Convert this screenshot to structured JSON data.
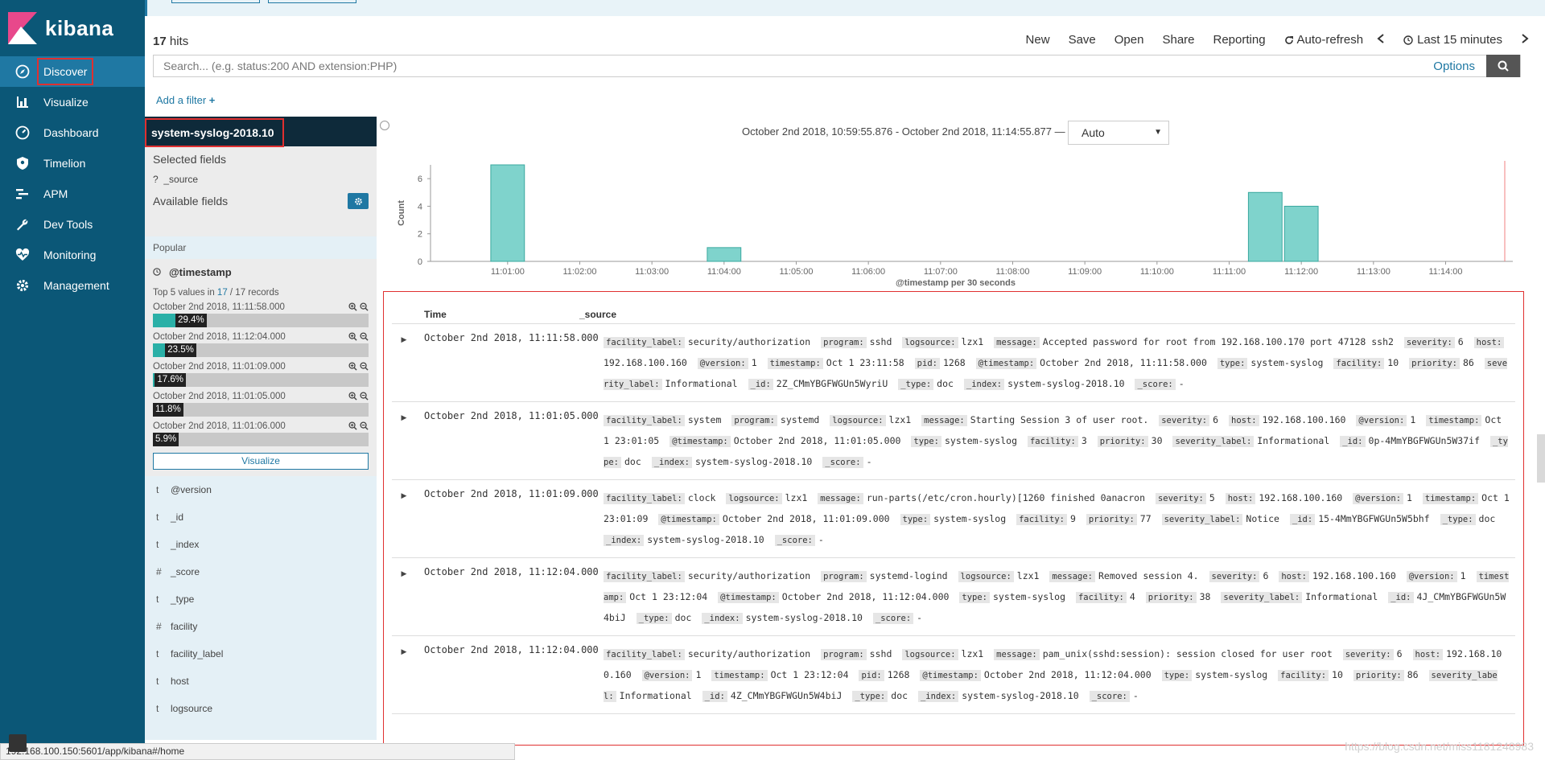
{
  "app": {
    "name": "kibana"
  },
  "nav": [
    {
      "label": "Discover",
      "icon": "compass-icon",
      "active": true
    },
    {
      "label": "Visualize",
      "icon": "bar-chart-icon"
    },
    {
      "label": "Dashboard",
      "icon": "dashboard-icon"
    },
    {
      "label": "Timelion",
      "icon": "shield-icon"
    },
    {
      "label": "APM",
      "icon": "apm-icon"
    },
    {
      "label": "Dev Tools",
      "icon": "wrench-icon"
    },
    {
      "label": "Monitoring",
      "icon": "heartbeat-icon"
    },
    {
      "label": "Management",
      "icon": "gear-icon"
    }
  ],
  "header": {
    "hits_count": "17",
    "hits_label": "hits",
    "menu": [
      "New",
      "Save",
      "Open",
      "Share",
      "Reporting"
    ],
    "auto_refresh": "Auto-refresh",
    "time_range": "Last 15 minutes"
  },
  "search": {
    "placeholder": "Search... (e.g. status:200 AND extension:PHP)",
    "options": "Options"
  },
  "filter": {
    "add": "Add a filter"
  },
  "sidebar": {
    "index": "system-syslog-2018.10",
    "selected_fields": "Selected fields",
    "source_field": "_source",
    "available_fields": "Available fields",
    "popular": "Popular",
    "timestamp_field": "@timestamp",
    "top5_prefix": "Top 5 values in",
    "top5_count": "17",
    "top5_suffix": "/ 17 records",
    "values": [
      {
        "label": "October 2nd 2018, 11:11:58.000",
        "pct": 29.4
      },
      {
        "label": "October 2nd 2018, 11:12:04.000",
        "pct": 23.5
      },
      {
        "label": "October 2nd 2018, 11:01:09.000",
        "pct": 17.6
      },
      {
        "label": "October 2nd 2018, 11:01:05.000",
        "pct": 11.8
      },
      {
        "label": "October 2nd 2018, 11:01:06.000",
        "pct": 5.9
      }
    ],
    "visualize_button": "Visualize",
    "fields": [
      {
        "type": "t",
        "name": "@version"
      },
      {
        "type": "t",
        "name": "_id"
      },
      {
        "type": "t",
        "name": "_index"
      },
      {
        "type": "#",
        "name": "_score"
      },
      {
        "type": "t",
        "name": "_type"
      },
      {
        "type": "#",
        "name": "facility"
      },
      {
        "type": "t",
        "name": "facility_label"
      },
      {
        "type": "t",
        "name": "host"
      },
      {
        "type": "t",
        "name": "logsource"
      }
    ]
  },
  "chart_header": {
    "range": "October 2nd 2018, 10:59:55.876 - October 2nd 2018, 11:14:55.877 —",
    "interval": "Auto"
  },
  "chart_data": {
    "type": "bar",
    "xlabel": "@timestamp per 30 seconds",
    "ylabel": "Count",
    "ylim": [
      0,
      7
    ],
    "yticks": [
      0,
      2,
      4,
      6
    ],
    "xticks": [
      "11:01:00",
      "11:02:00",
      "11:03:00",
      "11:04:00",
      "11:05:00",
      "11:06:00",
      "11:07:00",
      "11:08:00",
      "11:09:00",
      "11:10:00",
      "11:11:00",
      "11:12:00",
      "11:13:00",
      "11:14:00"
    ],
    "x_start": "10:59:55.876",
    "x_end": "11:14:55.877",
    "bucket_seconds": 30,
    "bars": [
      {
        "x": "11:01:00",
        "value": 7
      },
      {
        "x": "11:04:00",
        "value": 1
      },
      {
        "x": "11:11:30",
        "value": 5
      },
      {
        "x": "11:12:00",
        "value": 4
      }
    ],
    "grid": false,
    "bar_color": "#7fd3cc"
  },
  "table": {
    "col_time": "Time",
    "col_source": "_source",
    "rows": [
      {
        "time": "October 2nd 2018, 11:11:58.000",
        "fields": [
          [
            "facility_label:",
            "security/authorization"
          ],
          [
            "program:",
            "sshd"
          ],
          [
            "logsource:",
            "lzx1"
          ],
          [
            "message:",
            "Accepted password for root from 192.168.100.170 port 47128 ssh2"
          ],
          [
            "severity:",
            "6"
          ],
          [
            "host:",
            "192.168.100.160"
          ],
          [
            "@version:",
            "1"
          ],
          [
            "timestamp:",
            "Oct 1 23:11:58"
          ],
          [
            "pid:",
            "1268"
          ],
          [
            "@timestamp:",
            "October 2nd 2018, 11:11:58.000"
          ],
          [
            "type:",
            "system-syslog"
          ],
          [
            "facility:",
            "10"
          ],
          [
            "priority:",
            "86"
          ],
          [
            "severity_label:",
            "Informational"
          ],
          [
            "_id:",
            "2Z_CMmYBGFWGUn5WyriU"
          ],
          [
            "_type:",
            "doc"
          ],
          [
            "_index:",
            "system-syslog-2018.10"
          ],
          [
            "_score:",
            "-"
          ]
        ]
      },
      {
        "time": "October 2nd 2018, 11:01:05.000",
        "fields": [
          [
            "facility_label:",
            "system"
          ],
          [
            "program:",
            "systemd"
          ],
          [
            "logsource:",
            "lzx1"
          ],
          [
            "message:",
            "Starting Session 3 of user root."
          ],
          [
            "severity:",
            "6"
          ],
          [
            "host:",
            "192.168.100.160"
          ],
          [
            "@version:",
            "1"
          ],
          [
            "timestamp:",
            "Oct 1 23:01:05"
          ],
          [
            "@timestamp:",
            "October 2nd 2018, 11:01:05.000"
          ],
          [
            "type:",
            "system-syslog"
          ],
          [
            "facility:",
            "3"
          ],
          [
            "priority:",
            "30"
          ],
          [
            "severity_label:",
            "Informational"
          ],
          [
            "_id:",
            "0p-4MmYBGFWGUn5W37if"
          ],
          [
            "_type:",
            "doc"
          ],
          [
            "_index:",
            "system-syslog-2018.10"
          ],
          [
            "_score:",
            "-"
          ]
        ]
      },
      {
        "time": "October 2nd 2018, 11:01:09.000",
        "fields": [
          [
            "facility_label:",
            "clock"
          ],
          [
            "logsource:",
            "lzx1"
          ],
          [
            "message:",
            "run-parts(/etc/cron.hourly)[1260 finished 0anacron"
          ],
          [
            "severity:",
            "5"
          ],
          [
            "host:",
            "192.168.100.160"
          ],
          [
            "@version:",
            "1"
          ],
          [
            "timestamp:",
            "Oct 1 23:01:09"
          ],
          [
            "@timestamp:",
            "October 2nd 2018, 11:01:09.000"
          ],
          [
            "type:",
            "system-syslog"
          ],
          [
            "facility:",
            "9"
          ],
          [
            "priority:",
            "77"
          ],
          [
            "severity_label:",
            "Notice"
          ],
          [
            "_id:",
            "15-4MmYBGFWGUn5W5bhf"
          ],
          [
            "_type:",
            "doc"
          ],
          [
            "_index:",
            "system-syslog-2018.10"
          ],
          [
            "_score:",
            "-"
          ]
        ]
      },
      {
        "time": "October 2nd 2018, 11:12:04.000",
        "fields": [
          [
            "facility_label:",
            "security/authorization"
          ],
          [
            "program:",
            "systemd-logind"
          ],
          [
            "logsource:",
            "lzx1"
          ],
          [
            "message:",
            "Removed session 4."
          ],
          [
            "severity:",
            "6"
          ],
          [
            "host:",
            "192.168.100.160"
          ],
          [
            "@version:",
            "1"
          ],
          [
            "timestamp:",
            "Oct 1 23:12:04"
          ],
          [
            "@timestamp:",
            "October 2nd 2018, 11:12:04.000"
          ],
          [
            "type:",
            "system-syslog"
          ],
          [
            "facility:",
            "4"
          ],
          [
            "priority:",
            "38"
          ],
          [
            "severity_label:",
            "Informational"
          ],
          [
            "_id:",
            "4J_CMmYBGFWGUn5W4biJ"
          ],
          [
            "_type:",
            "doc"
          ],
          [
            "_index:",
            "system-syslog-2018.10"
          ],
          [
            "_score:",
            "-"
          ]
        ]
      },
      {
        "time": "October 2nd 2018, 11:12:04.000",
        "fields": [
          [
            "facility_label:",
            "security/authorization"
          ],
          [
            "program:",
            "sshd"
          ],
          [
            "logsource:",
            "lzx1"
          ],
          [
            "message:",
            "pam_unix(sshd:session): session closed for user root"
          ],
          [
            "severity:",
            "6"
          ],
          [
            "host:",
            "192.168.100.160"
          ],
          [
            "@version:",
            "1"
          ],
          [
            "timestamp:",
            "Oct 1 23:12:04"
          ],
          [
            "pid:",
            "1268"
          ],
          [
            "@timestamp:",
            "October 2nd 2018, 11:12:04.000"
          ],
          [
            "type:",
            "system-syslog"
          ],
          [
            "facility:",
            "10"
          ],
          [
            "priority:",
            "86"
          ],
          [
            "severity_label:",
            "Informational"
          ],
          [
            "_id:",
            "4Z_CMmYBGFWGUn5W4biJ"
          ],
          [
            "_type:",
            "doc"
          ],
          [
            "_index:",
            "system-syslog-2018.10"
          ],
          [
            "_score:",
            "-"
          ]
        ]
      }
    ]
  },
  "status": {
    "url": "192.168.100.150:5601/app/kibana#/home"
  },
  "watermark": "https://blog.csdn.net/miss1181248983"
}
